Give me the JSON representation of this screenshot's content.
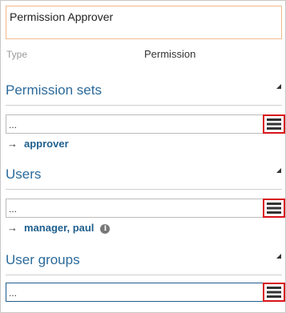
{
  "form": {
    "title_value": "Permission Approver",
    "type_label": "Type",
    "type_value": "Permission"
  },
  "sections": [
    {
      "title": "Permission sets",
      "lookup_value": "...",
      "links": [
        {
          "text": "approver"
        }
      ]
    },
    {
      "title": "Users",
      "lookup_value": "...",
      "links": [
        {
          "text": "manager, paul",
          "info_icon": "info-icon"
        }
      ]
    },
    {
      "title": "User groups",
      "lookup_value": "...",
      "links": []
    }
  ],
  "icons": {
    "menu": "hamburger-menu-icon",
    "arrow": "→",
    "info": "i"
  },
  "colors": {
    "section_title": "#2b6a9b",
    "link": "#1f5f8e",
    "title_border": "#f2b98d",
    "highlight_border": "#d9141b",
    "active_field_border": "#1f5f8e"
  }
}
